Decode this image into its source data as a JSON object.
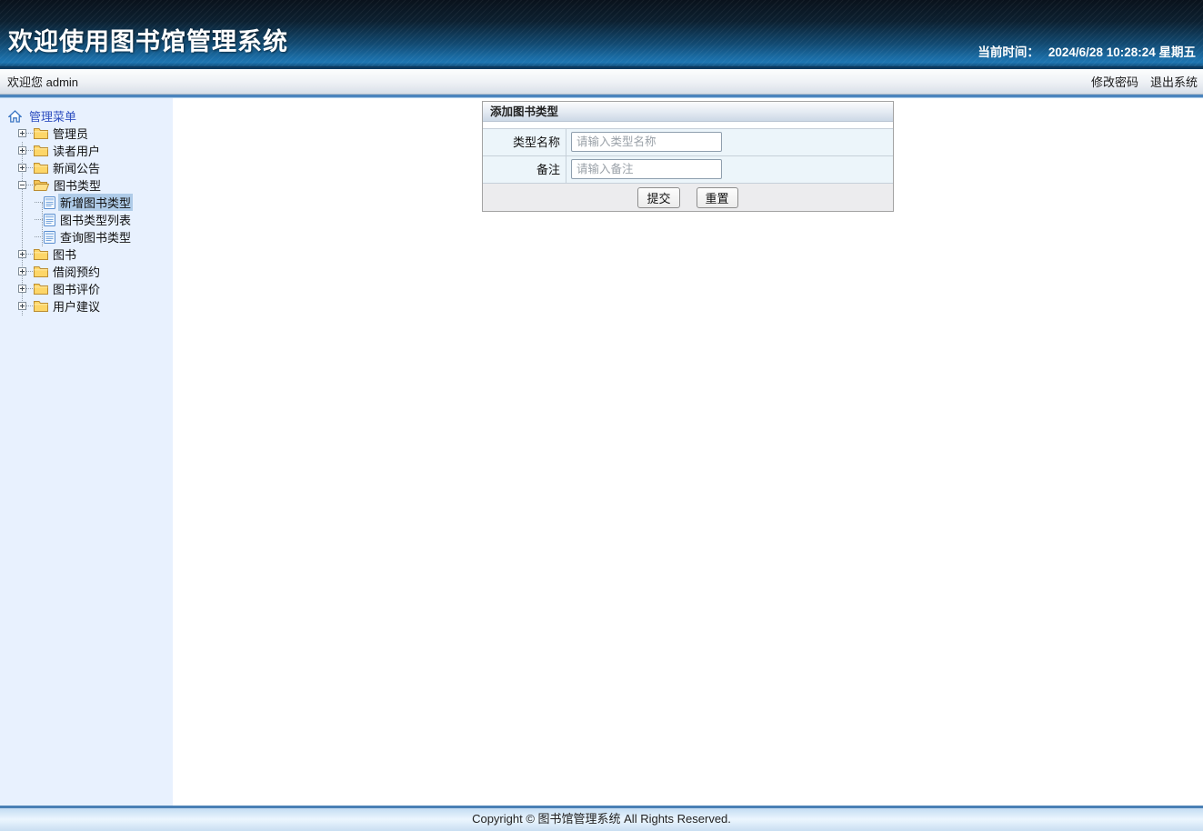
{
  "header": {
    "title": "欢迎使用图书馆管理系统",
    "time_label": "当前时间：",
    "time_value": "2024/6/28 10:28:24 星期五"
  },
  "topbar": {
    "welcome": "欢迎您 admin",
    "change_password": "修改密码",
    "logout": "退出系统"
  },
  "sidebar": {
    "root": "管理菜单",
    "items": [
      {
        "label": "管理员",
        "state": "collapsed"
      },
      {
        "label": "读者用户",
        "state": "collapsed"
      },
      {
        "label": "新闻公告",
        "state": "collapsed"
      },
      {
        "label": "图书类型",
        "state": "expanded",
        "children": [
          {
            "label": "新增图书类型",
            "selected": true
          },
          {
            "label": "图书类型列表",
            "selected": false
          },
          {
            "label": "查询图书类型",
            "selected": false
          }
        ]
      },
      {
        "label": "图书",
        "state": "collapsed"
      },
      {
        "label": "借阅预约",
        "state": "collapsed"
      },
      {
        "label": "图书评价",
        "state": "collapsed"
      },
      {
        "label": "用户建议",
        "state": "collapsed"
      }
    ]
  },
  "form": {
    "title": "添加图书类型",
    "fields": [
      {
        "label": "类型名称",
        "placeholder": "请输入类型名称",
        "value": ""
      },
      {
        "label": "备注",
        "placeholder": "请输入备注",
        "value": ""
      }
    ],
    "submit_label": "提交",
    "reset_label": "重置"
  },
  "footer": {
    "copyright": "Copyright © 图书馆管理系统 All Rights Reserved."
  },
  "colors": {
    "header_top": "#0a121c",
    "header_bottom": "#1e76b2",
    "divider_blue": "#4b84bd",
    "sidebar_bg": "#e8f1fe",
    "selected_highlight": "#aecbe8",
    "form_row_bg": "#ecf5fa",
    "footer_border": "#4a80b5"
  }
}
